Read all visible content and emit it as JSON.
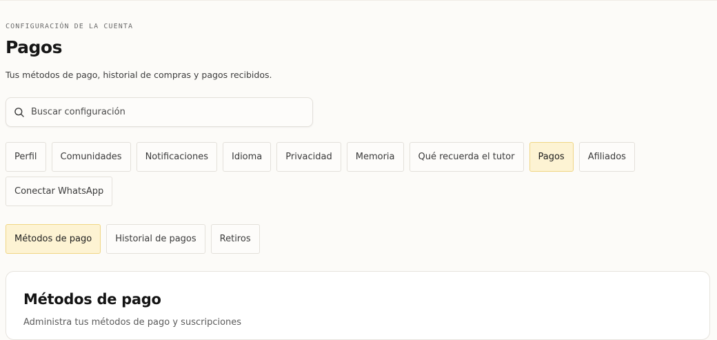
{
  "header": {
    "eyebrow": "CONFIGURACIÓN DE LA CUENTA",
    "title": "Pagos",
    "subtitle": "Tus métodos de pago, historial de compras y pagos recibidos."
  },
  "search": {
    "placeholder": "Buscar configuración",
    "value": "",
    "icon": "search-icon"
  },
  "main_tabs": [
    {
      "label": "Perfil",
      "active": false
    },
    {
      "label": "Comunidades",
      "active": false
    },
    {
      "label": "Notificaciones",
      "active": false
    },
    {
      "label": "Idioma",
      "active": false
    },
    {
      "label": "Privacidad",
      "active": false
    },
    {
      "label": "Memoria",
      "active": false
    },
    {
      "label": "Qué recuerda el tutor",
      "active": false
    },
    {
      "label": "Pagos",
      "active": true
    },
    {
      "label": "Afiliados",
      "active": false
    },
    {
      "label": "Conectar WhatsApp",
      "active": false
    }
  ],
  "sub_tabs": [
    {
      "label": "Métodos de pago",
      "active": true
    },
    {
      "label": "Historial de pagos",
      "active": false
    },
    {
      "label": "Retiros",
      "active": false
    }
  ],
  "card": {
    "title": "Métodos de pago",
    "subtitle": "Administra tus métodos de pago y suscripciones"
  },
  "colors": {
    "background": "#fcfbf8",
    "active_tab_bg": "#fdf3d3",
    "active_tab_border": "#f0d684",
    "border": "#e3e0da"
  }
}
